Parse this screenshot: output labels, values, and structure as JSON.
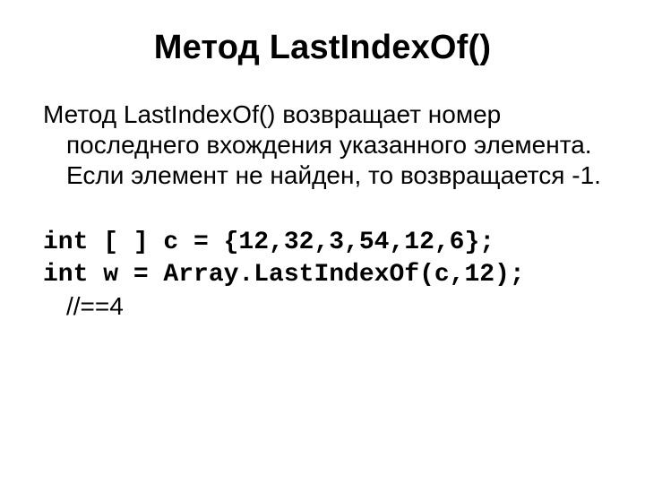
{
  "title": "Метод LastIndexOf()",
  "paragraph": "Метод LastIndexOf() возвращает номер последнего вхождения указанного элемента. Если элемент не найден, то возвращается -1.",
  "code_line1": "int [ ] c = {12,32,3,54,12,6};",
  "code_line2": "int w = Array.LastIndexOf(c,12);",
  "comment": "//==4"
}
